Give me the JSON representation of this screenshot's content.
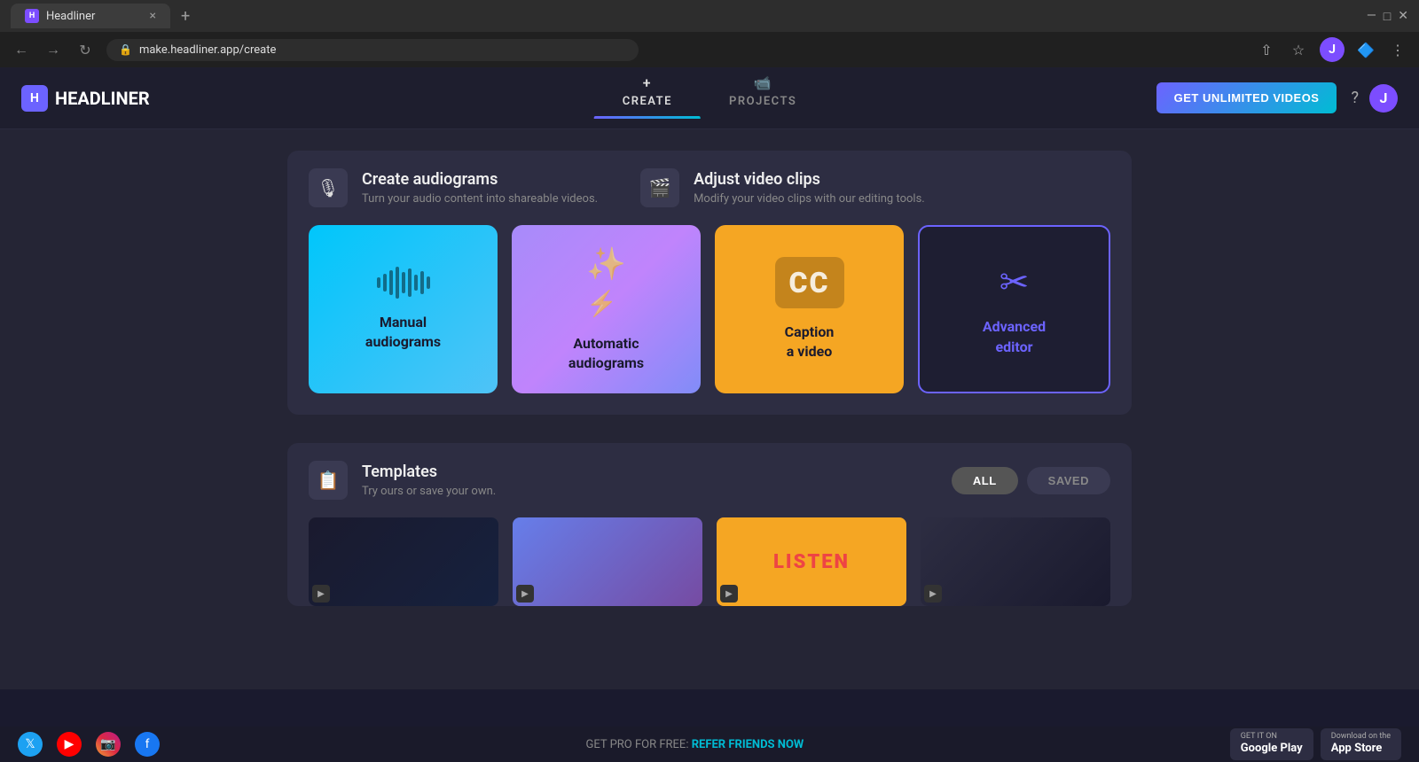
{
  "browser": {
    "tab_title": "Headliner",
    "tab_favicon": "H",
    "address": "make.headliner.app/create",
    "new_tab_label": "+",
    "close_tab_label": "×"
  },
  "header": {
    "logo_text": "HEADLINER",
    "logo_icon": "H",
    "get_unlimited_label": "GET UNLIMITED VIDEOS",
    "help_icon": "?",
    "profile_initial": "J"
  },
  "nav": {
    "tabs": [
      {
        "id": "create",
        "label": "CREATE",
        "icon": "+",
        "active": true
      },
      {
        "id": "projects",
        "label": "PROJECTS",
        "icon": "🎬",
        "active": false
      }
    ]
  },
  "audiograms_section": {
    "title": "Create audiograms",
    "subtitle": "Turn your audio content into shareable videos.",
    "icon": "🎙",
    "cards": [
      {
        "id": "manual",
        "label": "Manual\naudiograms",
        "type": "cyan"
      },
      {
        "id": "automatic",
        "label": "Automatic\naudiograms",
        "type": "purple"
      }
    ]
  },
  "video_section": {
    "title": "Adjust video clips",
    "subtitle": "Modify your video clips with our editing tools.",
    "icon": "🎬",
    "cards": [
      {
        "id": "caption",
        "label": "Caption\na video",
        "type": "orange",
        "icon": "CC"
      },
      {
        "id": "advanced",
        "label": "Advanced\neditor",
        "type": "dark",
        "icon": "✂"
      }
    ]
  },
  "templates_section": {
    "title": "Templates",
    "subtitle": "Try ours or save your own.",
    "icon": "📋",
    "filter_all_label": "ALL",
    "filter_saved_label": "SAVED",
    "active_filter": "all"
  },
  "bottom_bar": {
    "promo_text": "GET PRO FOR FREE: ",
    "promo_link": "REFER FRIENDS NOW",
    "app_store_label": "Download on the\nApp Store",
    "google_play_label": "GET IT ON\nGoogle Play"
  }
}
